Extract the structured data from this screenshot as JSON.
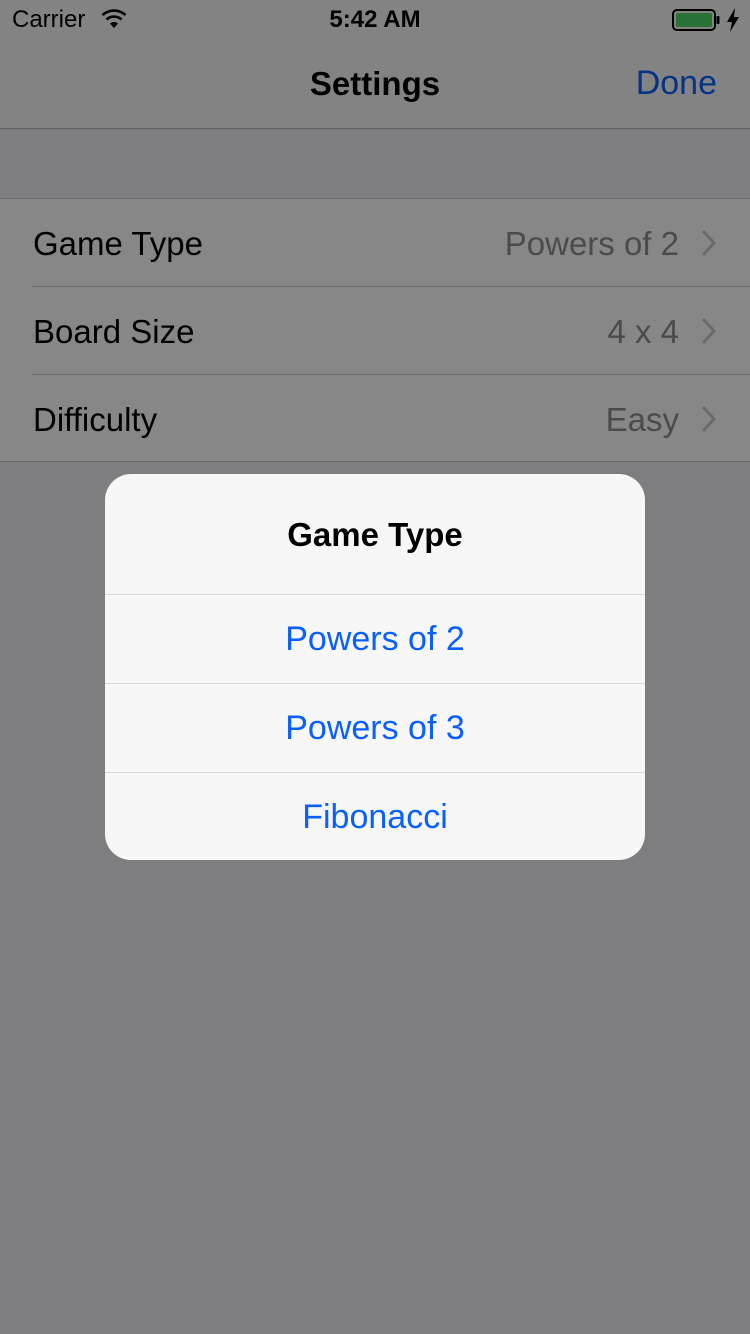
{
  "status_bar": {
    "carrier": "Carrier",
    "time": "5:42 AM",
    "icons": [
      "wifi-icon",
      "battery-icon",
      "charging-icon"
    ]
  },
  "nav_bar": {
    "title": "Settings",
    "done_label": "Done"
  },
  "settings": {
    "rows": [
      {
        "label": "Game Type",
        "value": "Powers of 2"
      },
      {
        "label": "Board Size",
        "value": "4 x 4"
      },
      {
        "label": "Difficulty",
        "value": "Easy"
      }
    ]
  },
  "alert": {
    "title": "Game Type",
    "actions": [
      "Powers of 2",
      "Powers of 3",
      "Fibonacci"
    ]
  },
  "colors": {
    "accent": "#0a60fe",
    "battery": "#4cd964",
    "value_text": "#8e8e93",
    "background": "#efeff4"
  }
}
